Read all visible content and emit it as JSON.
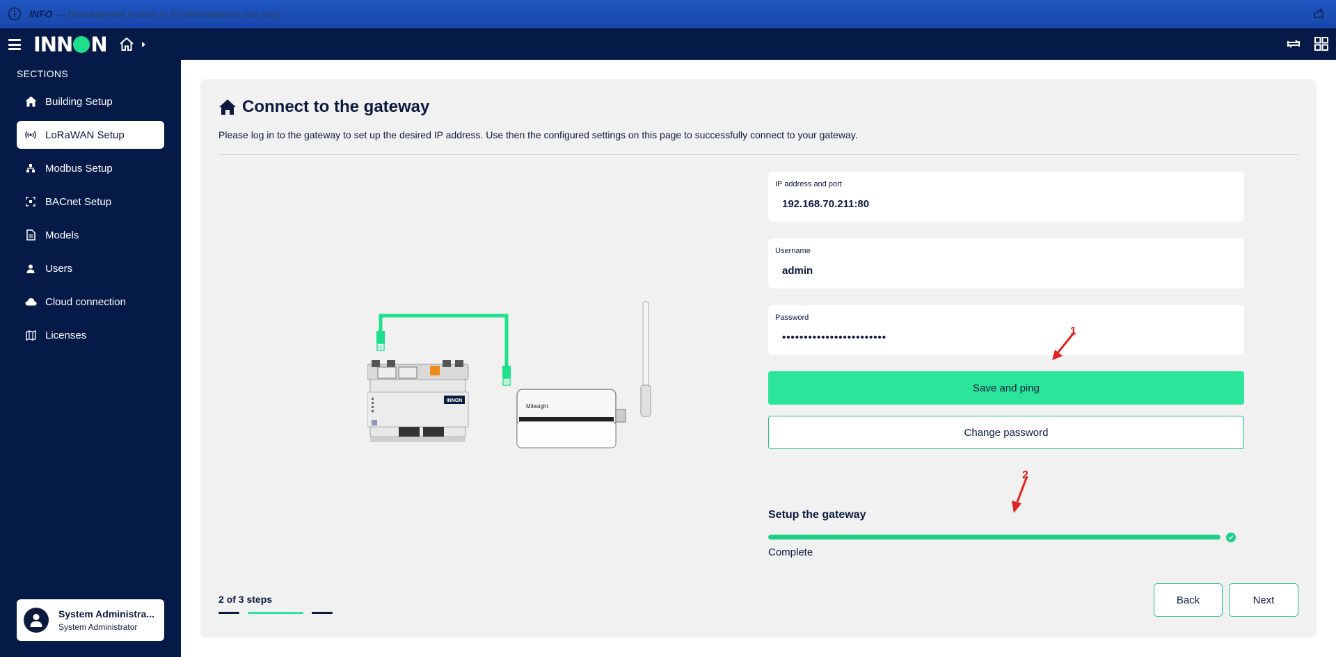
{
  "infobar": {
    "level": "INFO",
    "separator": " — ",
    "message": "Development license is for development use only."
  },
  "header": {
    "logo_text": "INNON",
    "icons": [
      "menu-icon",
      "home-icon",
      "breadcrumb-arrow-icon",
      "sync-icon",
      "grid-icon"
    ]
  },
  "sidebar": {
    "section_title": "SECTIONS",
    "items": [
      {
        "label": "Building Setup",
        "icon": "home-icon"
      },
      {
        "label": "LoRaWAN Setup",
        "icon": "radio-waves-icon",
        "active": true
      },
      {
        "label": "Modbus Setup",
        "icon": "network-tree-icon"
      },
      {
        "label": "BACnet Setup",
        "icon": "scan-icon"
      },
      {
        "label": "Models",
        "icon": "document-icon"
      },
      {
        "label": "Users",
        "icon": "user-icon"
      },
      {
        "label": "Cloud connection",
        "icon": "cloud-icon"
      },
      {
        "label": "Licenses",
        "icon": "map-icon"
      }
    ],
    "user": {
      "name": "System Administra...",
      "role": "System Administrator"
    }
  },
  "page": {
    "title": "Connect to the gateway",
    "description": "Please log in to the gateway to set up the desired IP address. Use then the configured settings on this page to successfully connect to your gateway.",
    "illustration": {
      "left_device_label": "INNON",
      "right_device_label": "Milesight"
    },
    "form": {
      "ip_label": "IP address and port",
      "ip_value": "192.168.70.211:80",
      "username_label": "Username",
      "username_value": "admin",
      "password_label": "Password",
      "password_value": "••••••••••••••••••••••••",
      "save_button": "Save and ping",
      "change_password_button": "Change password"
    },
    "annotations": {
      "one": "1",
      "two": "2"
    },
    "setup": {
      "title": "Setup the gateway",
      "progress": 1.0,
      "status": "Complete"
    },
    "steps": {
      "label": "2 of 3 steps",
      "current": 2,
      "total": 3
    },
    "back_button": "Back",
    "next_button": "Next"
  },
  "colors": {
    "navy": "#061a48",
    "accent_green": "#2ae59a",
    "info_blue": "#1f56c0",
    "annotation_red": "#e52020"
  }
}
